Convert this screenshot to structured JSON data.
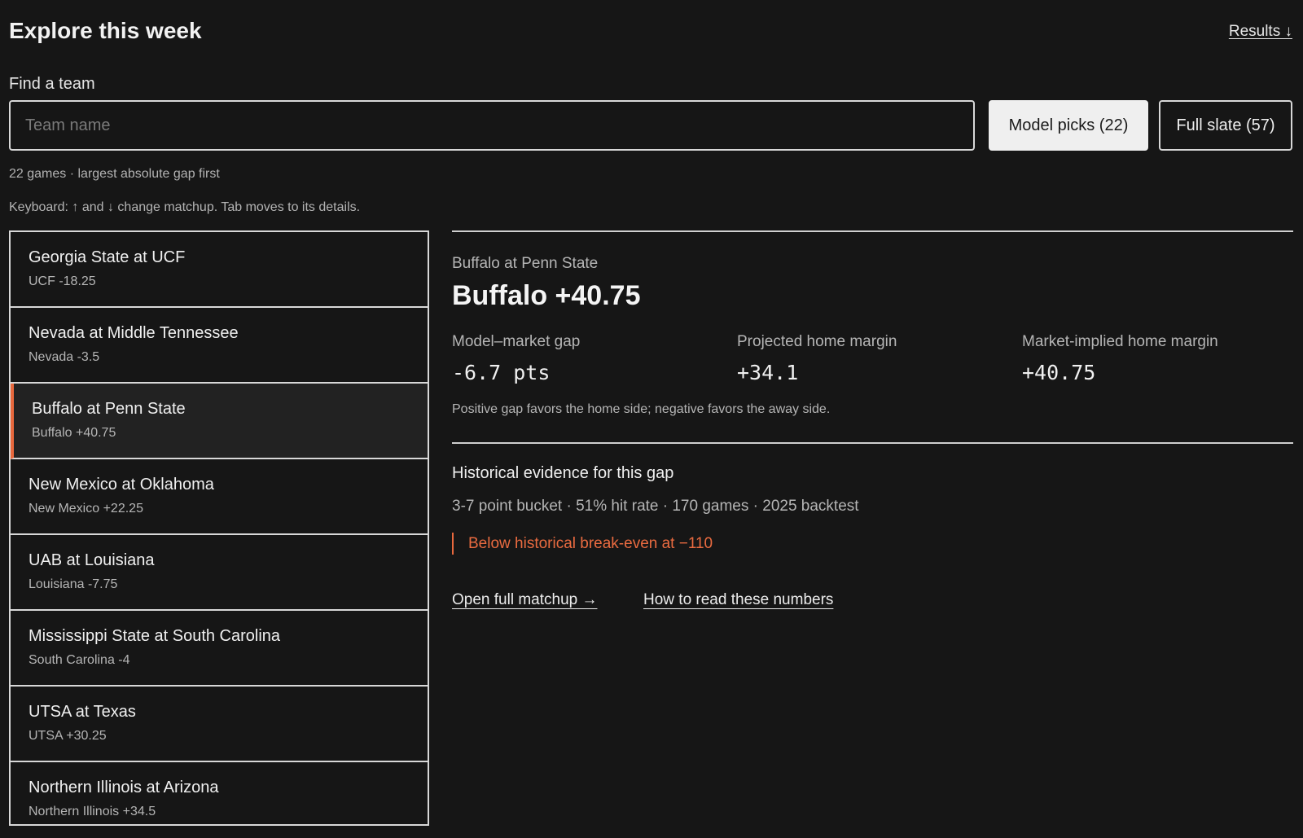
{
  "header": {
    "title": "Explore this week",
    "results_link": "Results ↓"
  },
  "search": {
    "label": "Find a team",
    "placeholder": "Team name",
    "value": ""
  },
  "filters": {
    "model_picks": "Model picks (22)",
    "full_slate": "Full slate (57)",
    "active": "model_picks"
  },
  "summary": "22 games · largest absolute gap first",
  "keyboard_hint": "Keyboard: ↑ and ↓ change matchup. Tab moves to its details.",
  "games": [
    {
      "title": "Georgia State at UCF",
      "line": "UCF -18.25"
    },
    {
      "title": "Nevada at Middle Tennessee",
      "line": "Nevada -3.5"
    },
    {
      "title": "Buffalo at Penn State",
      "line": "Buffalo +40.75",
      "selected": true
    },
    {
      "title": "New Mexico at Oklahoma",
      "line": "New Mexico +22.25"
    },
    {
      "title": "UAB at Louisiana",
      "line": "Louisiana -7.75"
    },
    {
      "title": "Mississippi State at South Carolina",
      "line": "South Carolina -4"
    },
    {
      "title": "UTSA at Texas",
      "line": "UTSA +30.25"
    },
    {
      "title": "Northern Illinois at Arizona",
      "line": "Northern Illinois +34.5"
    }
  ],
  "detail": {
    "matchup": "Buffalo at Penn State",
    "pick": "Buffalo +40.75",
    "stats": [
      {
        "label": "Model–market gap",
        "value": "-6.7 pts"
      },
      {
        "label": "Projected home margin",
        "value": "+34.1"
      },
      {
        "label": "Market-implied home margin",
        "value": "+40.75"
      }
    ],
    "note": "Positive gap favors the home side; negative favors the away side.",
    "history_title": "Historical evidence for this gap",
    "history_stats": "3-7 point bucket · 51% hit rate · 170 games · 2025 backtest",
    "warning": "Below historical break-even at −110",
    "links": {
      "open_matchup": "Open full matchup →",
      "how_to_read": "How to read these numbers"
    }
  },
  "colors": {
    "background": "#161616",
    "accent": "#e8683d"
  }
}
